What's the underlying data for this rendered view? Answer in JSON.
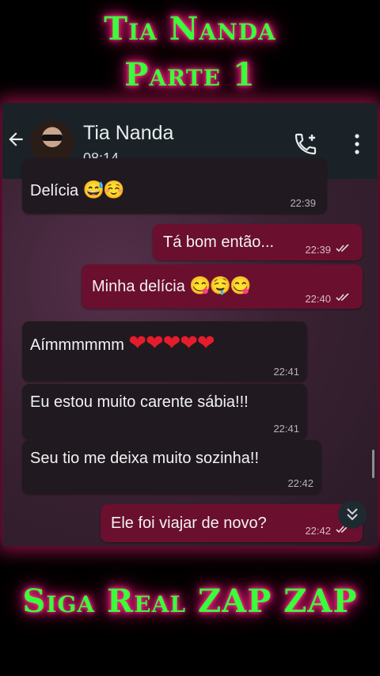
{
  "overlay": {
    "title_line1": "Tia Nanda",
    "title_line2": "Parte 1",
    "bottom_text": "Siga Real ZAP ZAP"
  },
  "header": {
    "contact_name": "Tia Nanda",
    "subtitle": "08:14",
    "icons": [
      "back-arrow-icon",
      "avatar",
      "add-call-icon",
      "more-vertical-icon"
    ]
  },
  "messages": [
    {
      "dir": "in",
      "text": "Delícia",
      "emoji": "😅☺️",
      "time": "22:39"
    },
    {
      "dir": "out",
      "text": "Tá bom então...",
      "time": "22:39",
      "read": true
    },
    {
      "dir": "out",
      "text": "Minha delícia",
      "emoji": "😋🤤😋",
      "time": "22:40",
      "read": true
    },
    {
      "dir": "in",
      "text": "Aímmmmmm",
      "emoji": "❤❤❤❤❤",
      "time": "22:41"
    },
    {
      "dir": "in",
      "text": "Eu estou muito carente sábia!!!",
      "time": "22:41"
    },
    {
      "dir": "in",
      "text": "Seu tio me deixa muito sozinha!!",
      "time": "22:42"
    },
    {
      "dir": "out",
      "text": "Ele foi viajar de novo?",
      "time": "22:42",
      "read": true
    }
  ],
  "colors": {
    "title_green": "#39ff3a",
    "glow_pink": "#ff2a8a",
    "header_bg": "#1b2227",
    "incoming_bubble": "#201a20",
    "outgoing_bubble": "#6b0f2e"
  }
}
